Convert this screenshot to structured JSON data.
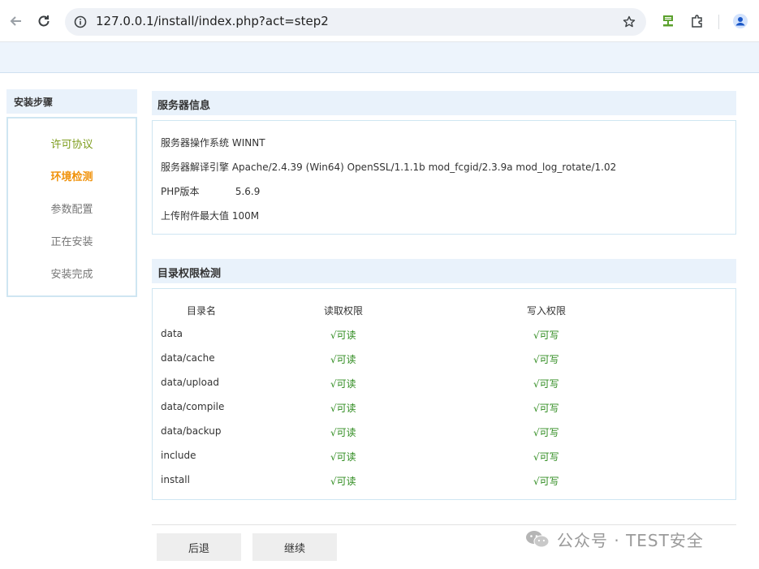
{
  "browser": {
    "url": "127.0.0.1/install/index.php?act=step2",
    "icons": [
      "back-arrow-icon",
      "reload-icon",
      "info-icon",
      "star-icon",
      "extension-green-icon",
      "puzzle-icon",
      "profile-icon"
    ]
  },
  "sidebar": {
    "title": "安装步骤",
    "steps": [
      {
        "label": "许可协议",
        "state": "done"
      },
      {
        "label": "环境检测",
        "state": "active"
      },
      {
        "label": "参数配置",
        "state": "pending"
      },
      {
        "label": "正在安装",
        "state": "pending"
      },
      {
        "label": "安装完成",
        "state": "pending"
      }
    ]
  },
  "server_info": {
    "title": "服务器信息",
    "rows": [
      {
        "label": "服务器操作系统",
        "value": "WINNT"
      },
      {
        "label": "服务器解译引擎",
        "value": "Apache/2.4.39 (Win64) OpenSSL/1.1.1b mod_fcgid/2.3.9a mod_log_rotate/1.02"
      },
      {
        "label": "PHP版本",
        "value": "5.6.9"
      },
      {
        "label": "上传附件最大值",
        "value": "100M"
      }
    ]
  },
  "dir_perms": {
    "title": "目录权限检测",
    "headers": {
      "dir": "目录名",
      "read": "读取权限",
      "write": "写入权限"
    },
    "rows": [
      {
        "dir": "data",
        "read": "√可读",
        "write": "√可写"
      },
      {
        "dir": "data/cache",
        "read": "√可读",
        "write": "√可写"
      },
      {
        "dir": "data/upload",
        "read": "√可读",
        "write": "√可写"
      },
      {
        "dir": "data/compile",
        "read": "√可读",
        "write": "√可写"
      },
      {
        "dir": "data/backup",
        "read": "√可读",
        "write": "√可写"
      },
      {
        "dir": "include",
        "read": "√可读",
        "write": "√可写"
      },
      {
        "dir": "install",
        "read": "√可读",
        "write": "√可写"
      }
    ]
  },
  "buttons": {
    "back": "后退",
    "next": "继续"
  },
  "watermark": {
    "text": "公众号 · TEST安全"
  },
  "colors": {
    "done_step": "#7e9d1e",
    "active_step": "#f0920b",
    "ok": "#2e8b1e",
    "section_bg": "#e9f2fb",
    "border": "#cfe6f2"
  }
}
